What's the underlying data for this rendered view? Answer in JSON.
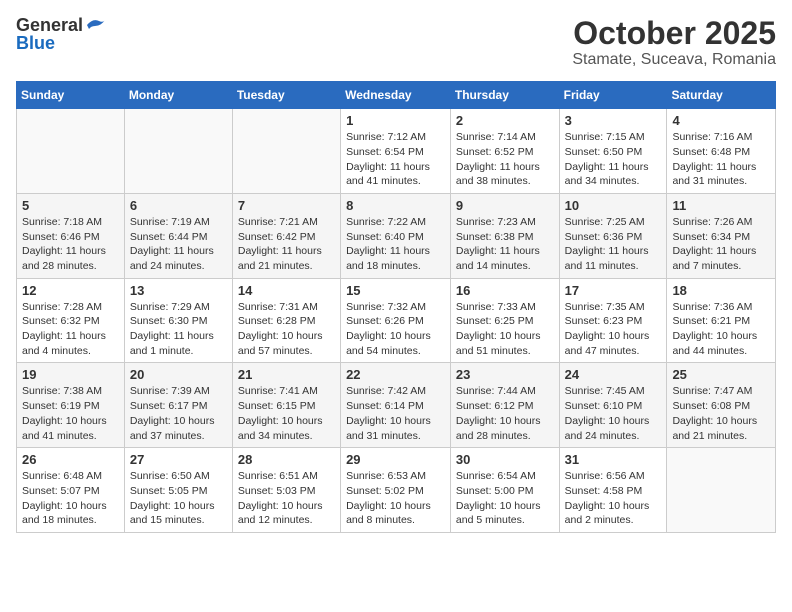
{
  "logo": {
    "general": "General",
    "blue": "Blue"
  },
  "title": "October 2025",
  "location": "Stamate, Suceava, Romania",
  "days_of_week": [
    "Sunday",
    "Monday",
    "Tuesday",
    "Wednesday",
    "Thursday",
    "Friday",
    "Saturday"
  ],
  "weeks": [
    [
      {
        "day": "",
        "info": ""
      },
      {
        "day": "",
        "info": ""
      },
      {
        "day": "",
        "info": ""
      },
      {
        "day": "1",
        "info": "Sunrise: 7:12 AM\nSunset: 6:54 PM\nDaylight: 11 hours and 41 minutes."
      },
      {
        "day": "2",
        "info": "Sunrise: 7:14 AM\nSunset: 6:52 PM\nDaylight: 11 hours and 38 minutes."
      },
      {
        "day": "3",
        "info": "Sunrise: 7:15 AM\nSunset: 6:50 PM\nDaylight: 11 hours and 34 minutes."
      },
      {
        "day": "4",
        "info": "Sunrise: 7:16 AM\nSunset: 6:48 PM\nDaylight: 11 hours and 31 minutes."
      }
    ],
    [
      {
        "day": "5",
        "info": "Sunrise: 7:18 AM\nSunset: 6:46 PM\nDaylight: 11 hours and 28 minutes."
      },
      {
        "day": "6",
        "info": "Sunrise: 7:19 AM\nSunset: 6:44 PM\nDaylight: 11 hours and 24 minutes."
      },
      {
        "day": "7",
        "info": "Sunrise: 7:21 AM\nSunset: 6:42 PM\nDaylight: 11 hours and 21 minutes."
      },
      {
        "day": "8",
        "info": "Sunrise: 7:22 AM\nSunset: 6:40 PM\nDaylight: 11 hours and 18 minutes."
      },
      {
        "day": "9",
        "info": "Sunrise: 7:23 AM\nSunset: 6:38 PM\nDaylight: 11 hours and 14 minutes."
      },
      {
        "day": "10",
        "info": "Sunrise: 7:25 AM\nSunset: 6:36 PM\nDaylight: 11 hours and 11 minutes."
      },
      {
        "day": "11",
        "info": "Sunrise: 7:26 AM\nSunset: 6:34 PM\nDaylight: 11 hours and 7 minutes."
      }
    ],
    [
      {
        "day": "12",
        "info": "Sunrise: 7:28 AM\nSunset: 6:32 PM\nDaylight: 11 hours and 4 minutes."
      },
      {
        "day": "13",
        "info": "Sunrise: 7:29 AM\nSunset: 6:30 PM\nDaylight: 11 hours and 1 minute."
      },
      {
        "day": "14",
        "info": "Sunrise: 7:31 AM\nSunset: 6:28 PM\nDaylight: 10 hours and 57 minutes."
      },
      {
        "day": "15",
        "info": "Sunrise: 7:32 AM\nSunset: 6:26 PM\nDaylight: 10 hours and 54 minutes."
      },
      {
        "day": "16",
        "info": "Sunrise: 7:33 AM\nSunset: 6:25 PM\nDaylight: 10 hours and 51 minutes."
      },
      {
        "day": "17",
        "info": "Sunrise: 7:35 AM\nSunset: 6:23 PM\nDaylight: 10 hours and 47 minutes."
      },
      {
        "day": "18",
        "info": "Sunrise: 7:36 AM\nSunset: 6:21 PM\nDaylight: 10 hours and 44 minutes."
      }
    ],
    [
      {
        "day": "19",
        "info": "Sunrise: 7:38 AM\nSunset: 6:19 PM\nDaylight: 10 hours and 41 minutes."
      },
      {
        "day": "20",
        "info": "Sunrise: 7:39 AM\nSunset: 6:17 PM\nDaylight: 10 hours and 37 minutes."
      },
      {
        "day": "21",
        "info": "Sunrise: 7:41 AM\nSunset: 6:15 PM\nDaylight: 10 hours and 34 minutes."
      },
      {
        "day": "22",
        "info": "Sunrise: 7:42 AM\nSunset: 6:14 PM\nDaylight: 10 hours and 31 minutes."
      },
      {
        "day": "23",
        "info": "Sunrise: 7:44 AM\nSunset: 6:12 PM\nDaylight: 10 hours and 28 minutes."
      },
      {
        "day": "24",
        "info": "Sunrise: 7:45 AM\nSunset: 6:10 PM\nDaylight: 10 hours and 24 minutes."
      },
      {
        "day": "25",
        "info": "Sunrise: 7:47 AM\nSunset: 6:08 PM\nDaylight: 10 hours and 21 minutes."
      }
    ],
    [
      {
        "day": "26",
        "info": "Sunrise: 6:48 AM\nSunset: 5:07 PM\nDaylight: 10 hours and 18 minutes."
      },
      {
        "day": "27",
        "info": "Sunrise: 6:50 AM\nSunset: 5:05 PM\nDaylight: 10 hours and 15 minutes."
      },
      {
        "day": "28",
        "info": "Sunrise: 6:51 AM\nSunset: 5:03 PM\nDaylight: 10 hours and 12 minutes."
      },
      {
        "day": "29",
        "info": "Sunrise: 6:53 AM\nSunset: 5:02 PM\nDaylight: 10 hours and 8 minutes."
      },
      {
        "day": "30",
        "info": "Sunrise: 6:54 AM\nSunset: 5:00 PM\nDaylight: 10 hours and 5 minutes."
      },
      {
        "day": "31",
        "info": "Sunrise: 6:56 AM\nSunset: 4:58 PM\nDaylight: 10 hours and 2 minutes."
      },
      {
        "day": "",
        "info": ""
      }
    ]
  ]
}
